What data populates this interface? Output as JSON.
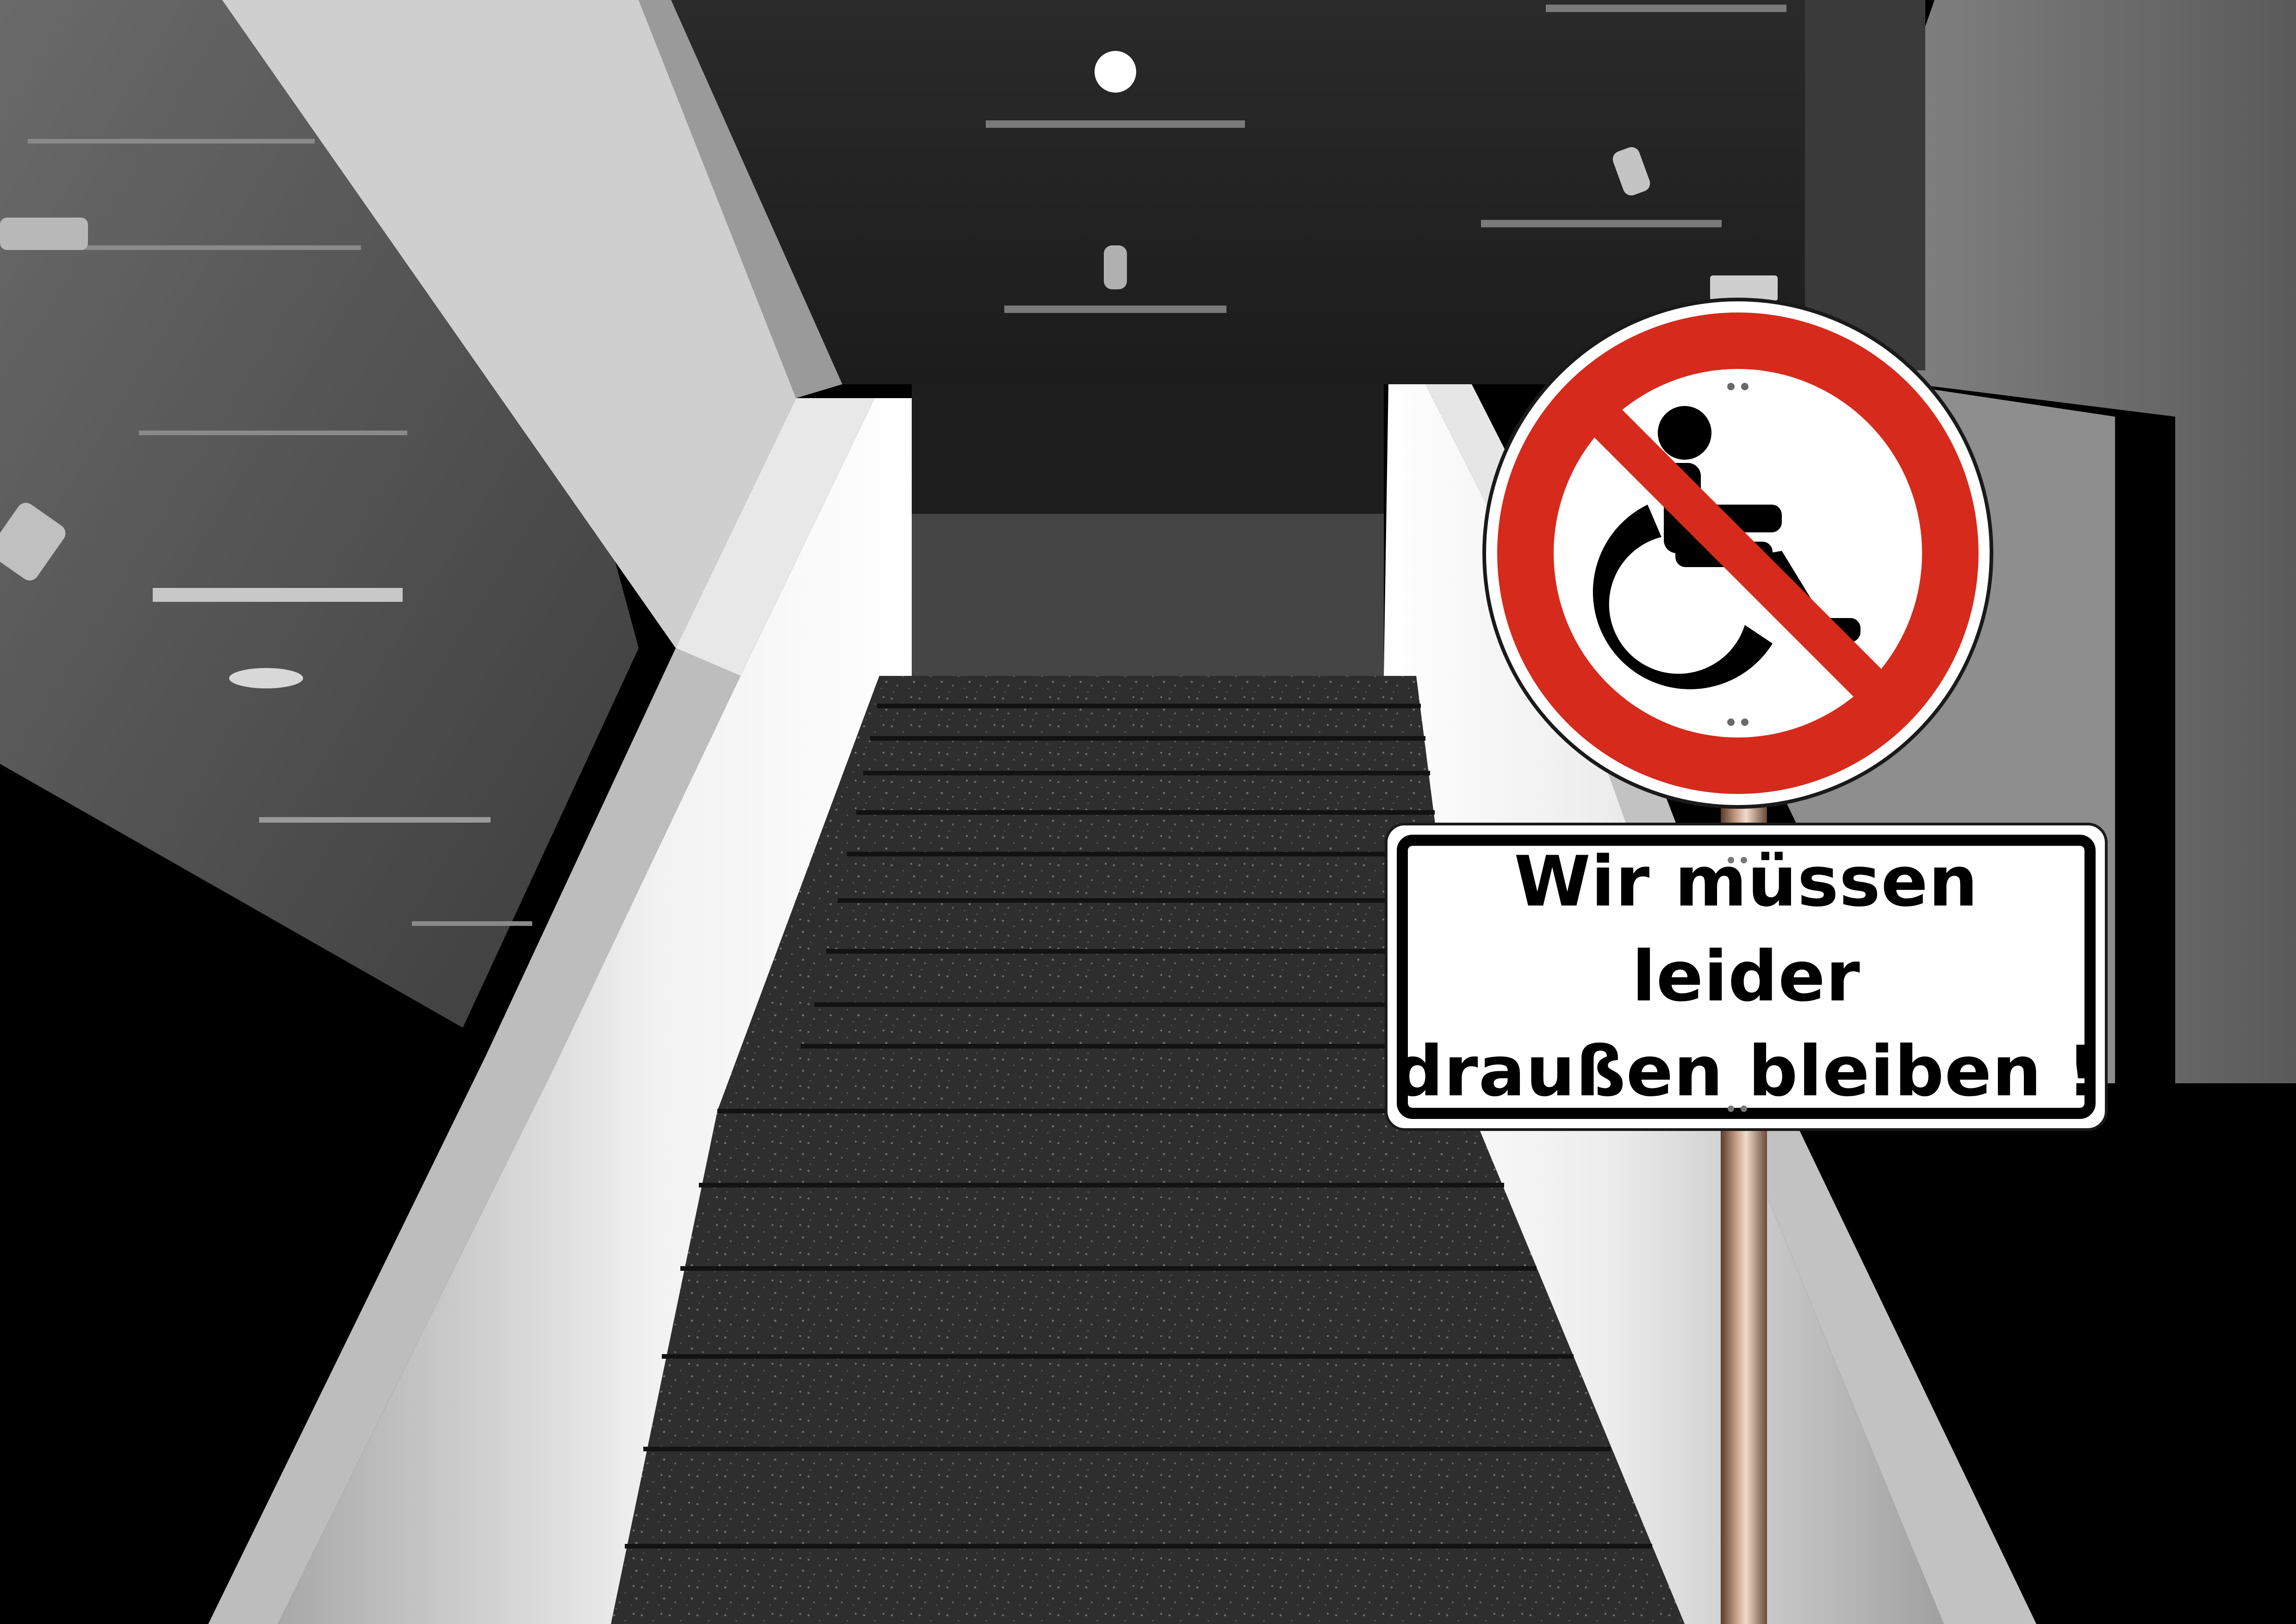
{
  "sign": {
    "symbol": "no-wheelchair-prohibition",
    "prohibition_color": "#d62a1c",
    "text_lines": [
      "Wir müssen",
      "leider",
      "draußen bleiben !"
    ]
  },
  "scene": {
    "subject": "staircase",
    "tint": "grayscale"
  }
}
